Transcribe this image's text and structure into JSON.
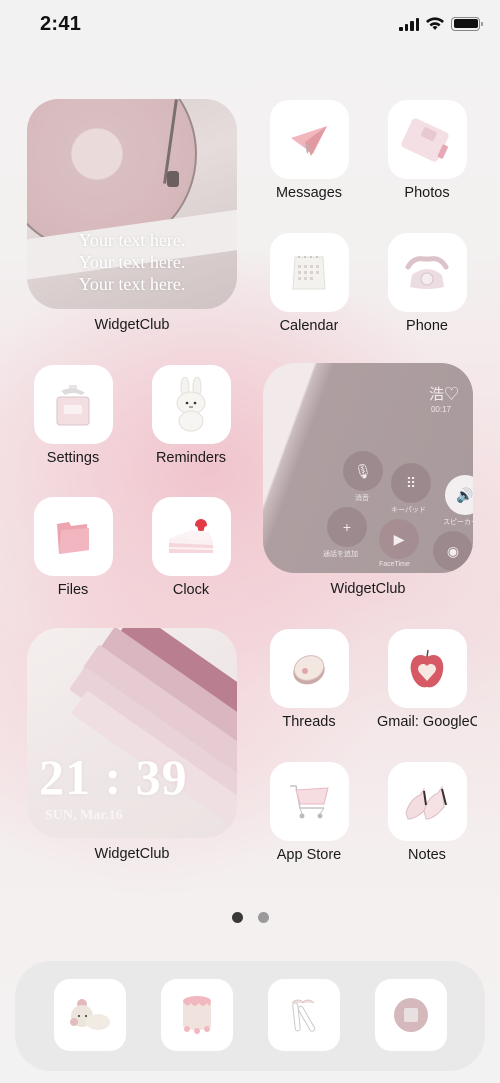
{
  "status_bar": {
    "time": "2:41",
    "signal_icon": "cellular-signal-icon",
    "wifi_icon": "wifi-icon",
    "battery_icon": "battery-icon",
    "battery_level": 1.0
  },
  "widgets": [
    {
      "label": "WidgetClub",
      "type": "text-photo",
      "lines": [
        "Your text here.",
        "Your text here.",
        "Your text here."
      ],
      "image": "pink-turntable"
    },
    {
      "label": "WidgetClub",
      "type": "phone-call-photo",
      "caller": "浩♡",
      "duration": "00:17",
      "buttons": [
        "消音",
        "キーパッド",
        "スピーカー",
        "通話を追加",
        "FaceTime"
      ],
      "image": "phone-call-screen"
    },
    {
      "label": "WidgetClub",
      "type": "clock-photo",
      "time": "21 : 39",
      "date": "SUN, Mar.16",
      "image": "twice-books"
    }
  ],
  "apps": [
    {
      "label": "Messages",
      "icon": "paper-plane-icon"
    },
    {
      "label": "Photos",
      "icon": "pink-planner-icon"
    },
    {
      "label": "Calendar",
      "icon": "desk-calendar-icon"
    },
    {
      "label": "Phone",
      "icon": "rotary-phone-icon"
    },
    {
      "label": "Settings",
      "icon": "perfume-bottle-icon"
    },
    {
      "label": "Reminders",
      "icon": "white-bunny-plush-icon"
    },
    {
      "label": "Files",
      "icon": "pink-folder-icon"
    },
    {
      "label": "Clock",
      "icon": "strawberry-cake-icon"
    },
    {
      "label": "Threads",
      "icon": "lip-balm-tin-icon"
    },
    {
      "label": "Gmail: GoogleC",
      "icon": "heart-apple-icon"
    },
    {
      "label": "App Store",
      "icon": "shopping-cart-icon"
    },
    {
      "label": "Notes",
      "icon": "pink-heels-icon"
    }
  ],
  "page_indicator": {
    "pages": 2,
    "current": 1,
    "active_color": "#3a3a3a",
    "inactive_color": "#9a9a9a"
  },
  "dock": [
    {
      "icon": "teddy-bear-icon"
    },
    {
      "icon": "pink-cake-stand-icon"
    },
    {
      "icon": "bow-hair-clips-icon"
    },
    {
      "icon": "compact-mirror-icon"
    }
  ]
}
